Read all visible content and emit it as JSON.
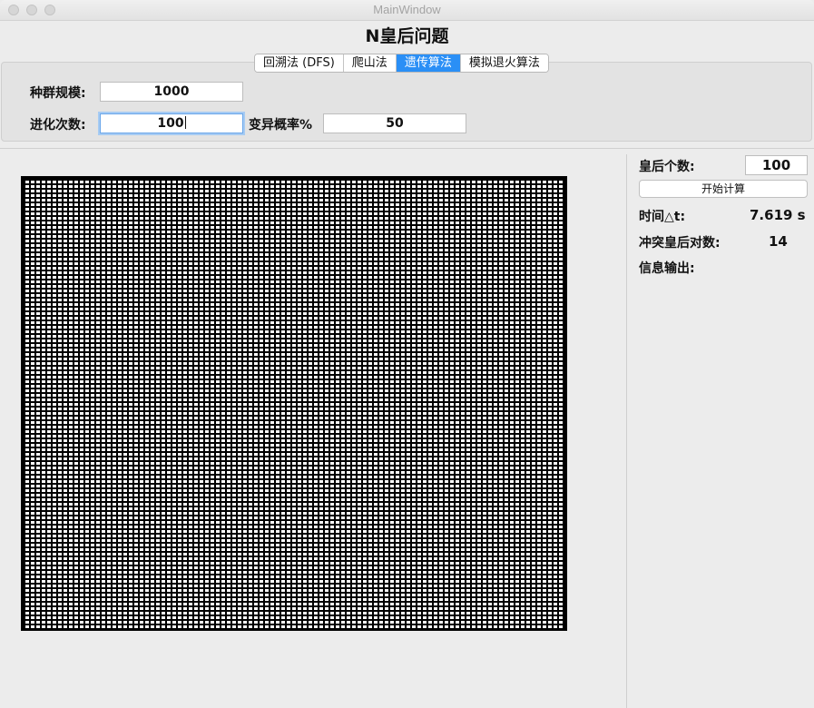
{
  "window": {
    "title": "MainWindow"
  },
  "heading": "N皇后问题",
  "tabs": [
    {
      "label": "回溯法 (DFS)",
      "active": false
    },
    {
      "label": "爬山法",
      "active": false
    },
    {
      "label": "遗传算法",
      "active": true
    },
    {
      "label": "模拟退火算法",
      "active": false
    }
  ],
  "params": {
    "population_label": "种群规模:",
    "population_value": "1000",
    "generations_label": "进化次数:",
    "generations_value": "100",
    "mutation_label": "变异概率%",
    "mutation_value": "50"
  },
  "side": {
    "queens_label": "皇后个数:",
    "queens_value": "100",
    "start_button": "开始计算",
    "time_label": "时间△t:",
    "time_value": "7.619  s",
    "conflicts_label": "冲突皇后对数:",
    "conflicts_value": "14",
    "info_label": "信息输出:"
  },
  "board": {
    "size": 100
  },
  "colors": {
    "accent": "#2a8ff6",
    "background": "#ececec",
    "panel": "#e3e3e3"
  }
}
